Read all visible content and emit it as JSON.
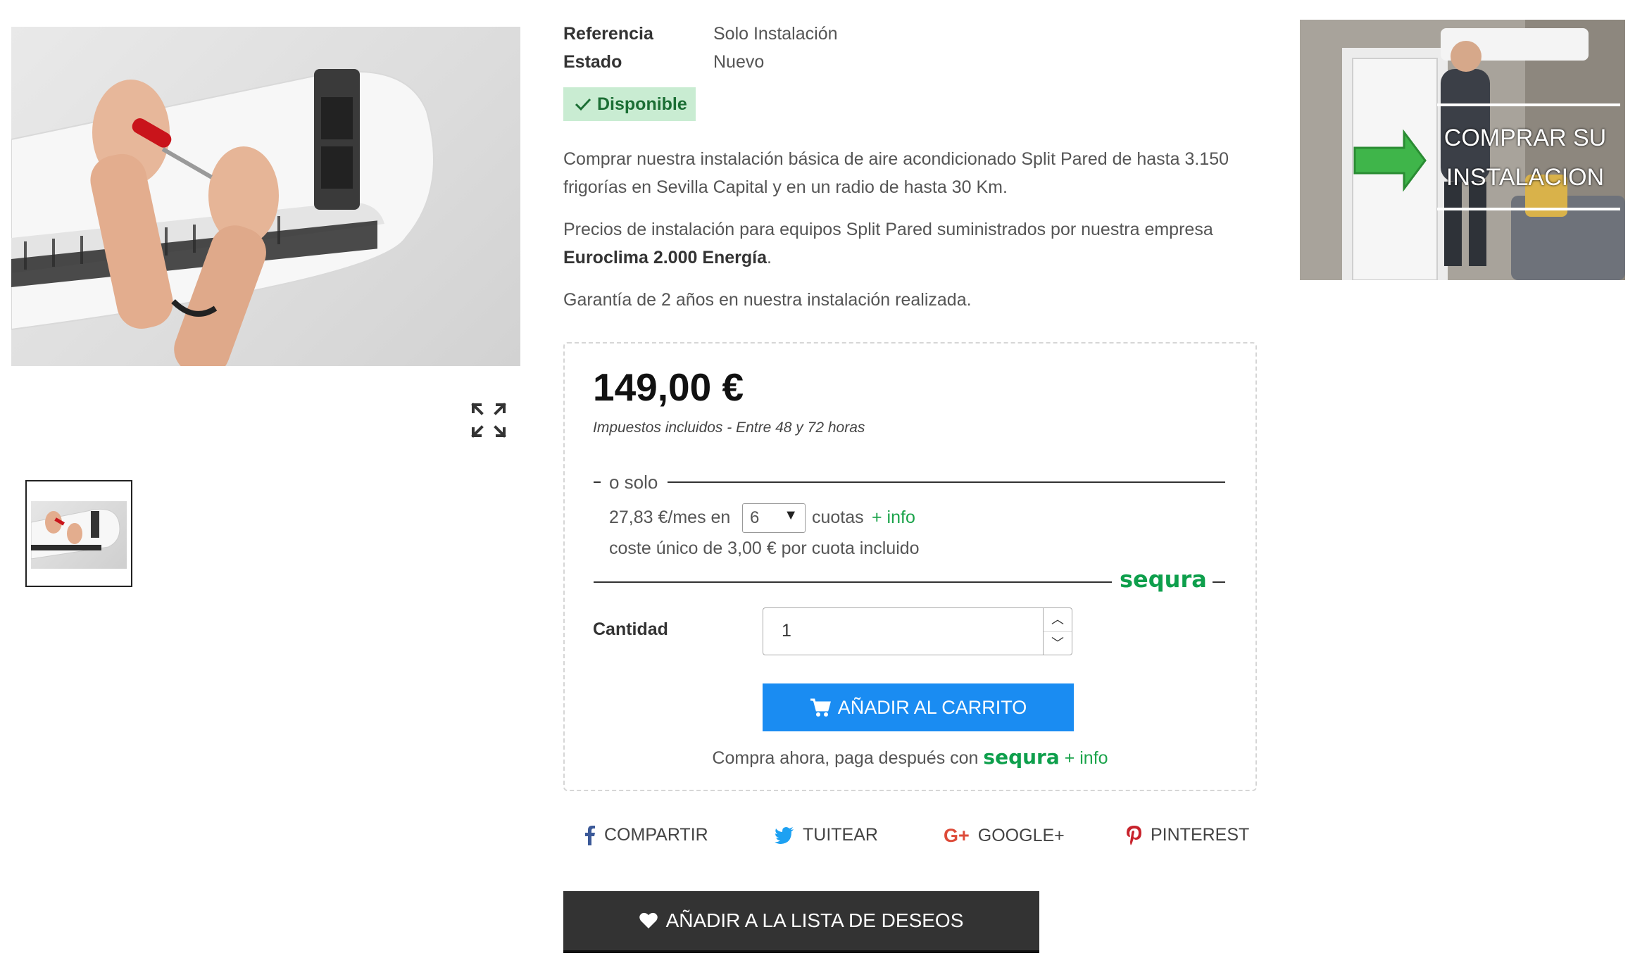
{
  "product": {
    "reference_label": "Referencia",
    "reference_value": "Solo Instalación",
    "state_label": "Estado",
    "state_value": "Nuevo",
    "availability": "Disponible",
    "desc1": "Comprar nuestra instalación básica de aire acondicionado Split Pared de hasta 3.150 frigorías en Sevilla Capital y en un radio de hasta 30 Km.",
    "desc2_prefix": "Precios de instalación para equipos Split Pared suministrados por nuestra empresa ",
    "desc2_bold": "Euroclima 2.000 Energía",
    "desc2_suffix": ".",
    "desc3": "Garantía de 2 años en nuestra instalación realizada."
  },
  "promo": {
    "line1": "COMPRAR SU",
    "line2": "INSTALACION"
  },
  "buybox": {
    "price": "149,00 €",
    "tax_note": "Impuestos incluidos  - Entre 48 y 72 horas",
    "o_solo": "o solo",
    "installment_amount": "27,83 €/mes en",
    "installments_selected": "6",
    "cuotas": "cuotas",
    "more_info": "+ info",
    "fee_note": "coste único de 3,00 € por cuota incluido",
    "sequra_brand": "sequra",
    "quantity_label": "Cantidad",
    "quantity_value": "1",
    "add_to_cart": "AÑADIR AL CARRITO",
    "buy_now_text": "Compra ahora, paga después con",
    "buy_now_info": "+ info"
  },
  "share": {
    "facebook": "COMPARTIR",
    "twitter": "TUITEAR",
    "google": "GOOGLE+",
    "pinterest": "PINTEREST"
  },
  "wishlist": "AÑADIR A LA LISTA DE DESEOS",
  "colors": {
    "accent_blue": "#1a8cf2",
    "sequra_green": "#0e9f4c",
    "badge_bg": "#c9ecd2",
    "dark_button": "#333333"
  }
}
